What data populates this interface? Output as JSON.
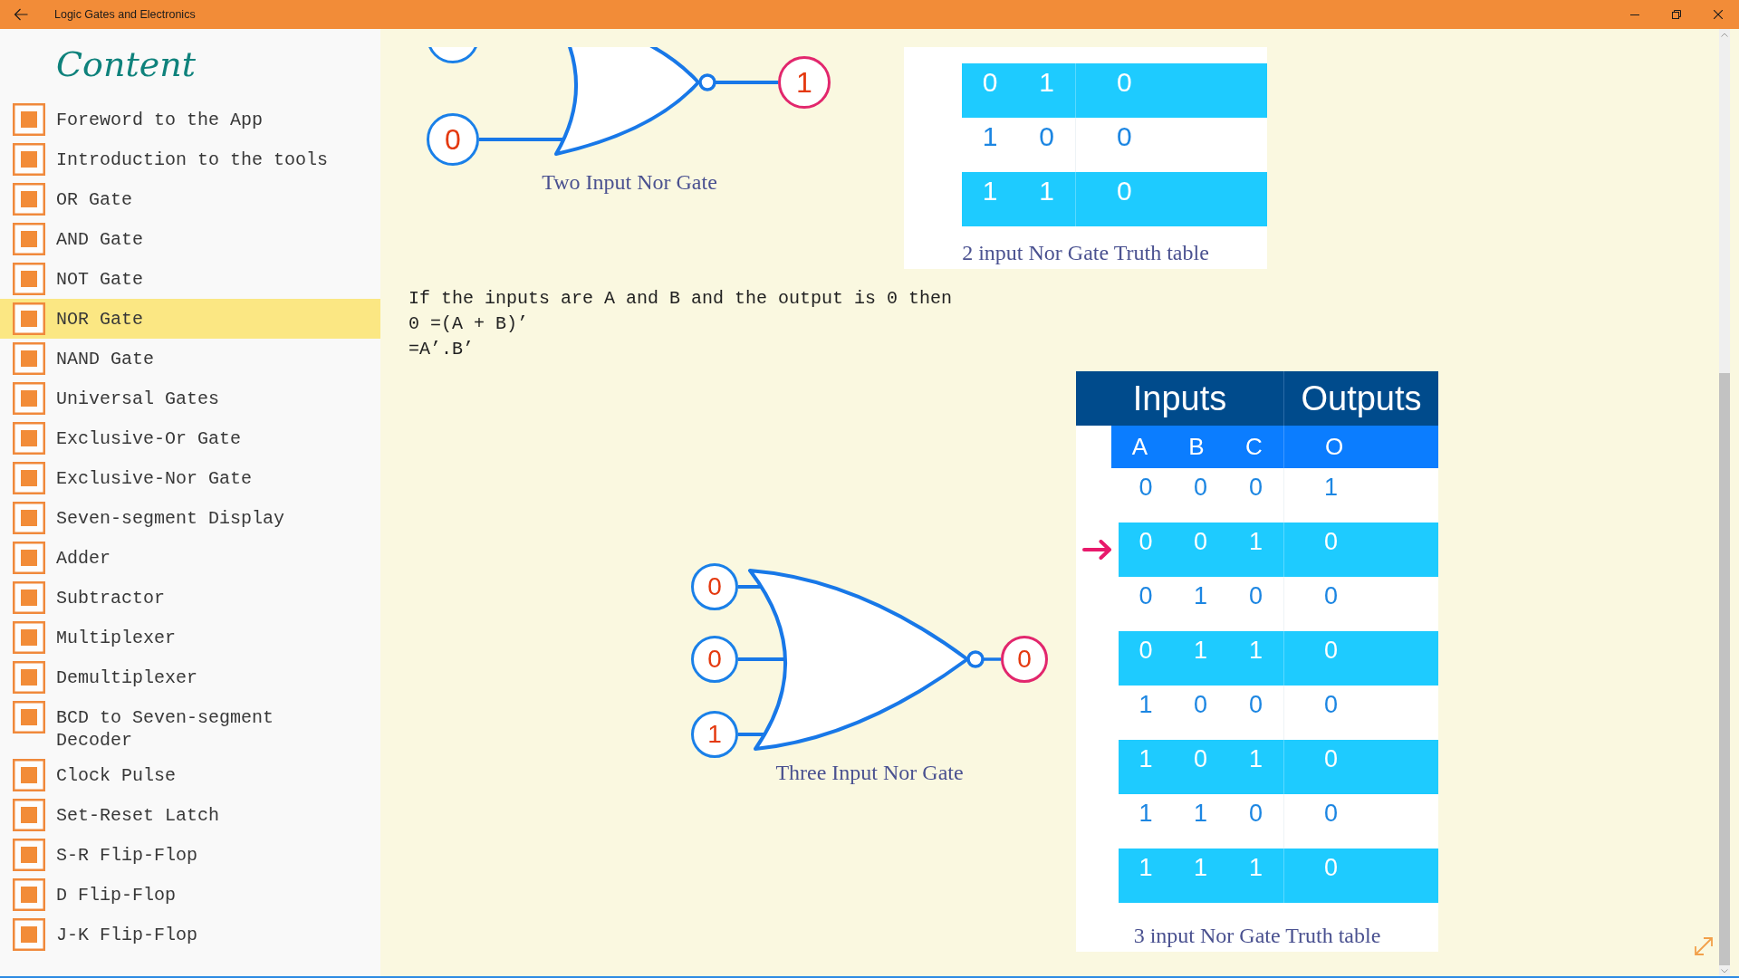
{
  "window": {
    "title": "Logic Gates and Electronics"
  },
  "sidebar": {
    "heading": "Content",
    "items": [
      {
        "label": "Foreword to the App",
        "selected": false
      },
      {
        "label": "Introduction to the tools",
        "selected": false
      },
      {
        "label": "OR Gate",
        "selected": false
      },
      {
        "label": "AND Gate",
        "selected": false
      },
      {
        "label": "NOT Gate",
        "selected": false
      },
      {
        "label": "NOR Gate",
        "selected": true
      },
      {
        "label": "NAND Gate",
        "selected": false
      },
      {
        "label": "Universal Gates",
        "selected": false
      },
      {
        "label": "Exclusive-Or Gate",
        "selected": false
      },
      {
        "label": "Exclusive-Nor Gate",
        "selected": false
      },
      {
        "label": "Seven-segment Display",
        "selected": false
      },
      {
        "label": "Adder",
        "selected": false
      },
      {
        "label": "Subtractor",
        "selected": false
      },
      {
        "label": "Multiplexer",
        "selected": false
      },
      {
        "label": "Demultiplexer",
        "selected": false
      },
      {
        "label": "BCD to Seven-segment Decoder",
        "selected": false
      },
      {
        "label": "Clock Pulse",
        "selected": false
      },
      {
        "label": "Set-Reset Latch",
        "selected": false
      },
      {
        "label": "S-R Flip-Flop",
        "selected": false
      },
      {
        "label": "D Flip-Flop",
        "selected": false
      },
      {
        "label": "J-K Flip-Flop",
        "selected": false
      }
    ]
  },
  "two_input_gate": {
    "inputs": [
      "0"
    ],
    "output": "1",
    "caption": "Two Input Nor Gate"
  },
  "two_input_table": {
    "rows": [
      {
        "cells": [
          "0",
          "1",
          "0"
        ],
        "shaded": true
      },
      {
        "cells": [
          "1",
          "0",
          "0"
        ],
        "shaded": false
      },
      {
        "cells": [
          "1",
          "1",
          "0"
        ],
        "shaded": true
      }
    ],
    "caption": "2 input Nor Gate Truth table"
  },
  "explanation": {
    "lines": [
      "If the inputs are A and B and the output is 0 then",
      "0 =(A + B)’",
      "=A’.B’"
    ]
  },
  "three_input_gate": {
    "inputs": [
      "0",
      "0",
      "1"
    ],
    "output": "0",
    "caption": "Three Input Nor Gate"
  },
  "three_input_table": {
    "groups": [
      "Inputs",
      "Outputs"
    ],
    "columns": [
      "A",
      "B",
      "C",
      "O"
    ],
    "rows": [
      {
        "cells": [
          "0",
          "0",
          "0",
          "1"
        ],
        "shaded": false,
        "pointer": false
      },
      {
        "cells": [
          "0",
          "0",
          "1",
          "0"
        ],
        "shaded": true,
        "pointer": true
      },
      {
        "cells": [
          "0",
          "1",
          "0",
          "0"
        ],
        "shaded": false,
        "pointer": false
      },
      {
        "cells": [
          "0",
          "1",
          "1",
          "0"
        ],
        "shaded": true,
        "pointer": false
      },
      {
        "cells": [
          "1",
          "0",
          "0",
          "0"
        ],
        "shaded": false,
        "pointer": false
      },
      {
        "cells": [
          "1",
          "0",
          "1",
          "0"
        ],
        "shaded": true,
        "pointer": false
      },
      {
        "cells": [
          "1",
          "1",
          "0",
          "0"
        ],
        "shaded": false,
        "pointer": false
      },
      {
        "cells": [
          "1",
          "1",
          "1",
          "0"
        ],
        "shaded": true,
        "pointer": false
      }
    ],
    "caption": "3 input Nor Gate Truth table"
  }
}
